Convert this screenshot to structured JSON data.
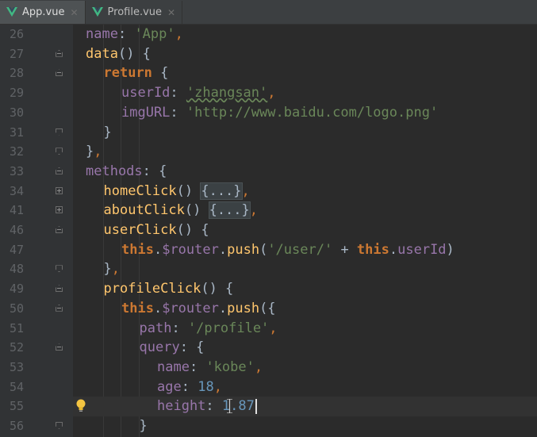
{
  "tabs": [
    {
      "label": "App.vue",
      "icon": "vue-icon",
      "active": true
    },
    {
      "label": "Profile.vue",
      "icon": "vue-icon",
      "active": false
    }
  ],
  "colors": {
    "background": "#2b2b2b",
    "gutter": "#313335",
    "vue_green": "#41b883",
    "keyword": "#cc7832",
    "string": "#6a8759",
    "property": "#9876aa",
    "function": "#ffc66d",
    "number": "#6897bb"
  },
  "editor": {
    "current_line_number": "55",
    "lines": [
      {
        "num": "26",
        "fold": "",
        "tokens": [
          {
            "t": "name",
            "c": "tok-prop"
          },
          {
            "t": ": ",
            "c": "tok-plain"
          },
          {
            "t": "'App'",
            "c": "tok-str"
          },
          {
            "t": ",",
            "c": "tok-punc"
          }
        ],
        "indent": 0
      },
      {
        "num": "27",
        "fold": "open-top",
        "tokens": [
          {
            "t": "data",
            "c": "tok-fn"
          },
          {
            "t": "() {",
            "c": "tok-plain"
          }
        ],
        "indent": 0
      },
      {
        "num": "28",
        "fold": "open-top",
        "tokens": [
          {
            "t": "return",
            "c": "tok-kw"
          },
          {
            "t": " {",
            "c": "tok-plain"
          }
        ],
        "indent": 1
      },
      {
        "num": "29",
        "fold": "",
        "tokens": [
          {
            "t": "userId",
            "c": "tok-prop"
          },
          {
            "t": ": ",
            "c": "tok-plain"
          },
          {
            "t": "'zhangsan'",
            "c": "tok-str tok-underline"
          },
          {
            "t": ",",
            "c": "tok-punc"
          }
        ],
        "indent": 2
      },
      {
        "num": "30",
        "fold": "",
        "tokens": [
          {
            "t": "imgURL",
            "c": "tok-prop"
          },
          {
            "t": ": ",
            "c": "tok-plain"
          },
          {
            "t": "'http://www.baidu.com/logo.png'",
            "c": "tok-str"
          }
        ],
        "indent": 2
      },
      {
        "num": "31",
        "fold": "close-bottom",
        "tokens": [
          {
            "t": "}",
            "c": "tok-plain"
          }
        ],
        "indent": 1
      },
      {
        "num": "32",
        "fold": "close-bottom",
        "tokens": [
          {
            "t": "}",
            "c": "tok-plain"
          },
          {
            "t": ",",
            "c": "tok-punc"
          }
        ],
        "indent": 0
      },
      {
        "num": "33",
        "fold": "open-top",
        "tokens": [
          {
            "t": "methods",
            "c": "tok-prop"
          },
          {
            "t": ": {",
            "c": "tok-plain"
          }
        ],
        "indent": 0
      },
      {
        "num": "34",
        "fold": "plus",
        "tokens": [
          {
            "t": "homeClick",
            "c": "tok-fn"
          },
          {
            "t": "() ",
            "c": "tok-plain"
          },
          {
            "t": "{...}",
            "c": "tok-fold"
          },
          {
            "t": ",",
            "c": "tok-punc"
          }
        ],
        "indent": 1
      },
      {
        "num": "41",
        "fold": "plus",
        "tokens": [
          {
            "t": "aboutClick",
            "c": "tok-fn"
          },
          {
            "t": "() ",
            "c": "tok-plain"
          },
          {
            "t": "{...}",
            "c": "tok-fold"
          },
          {
            "t": ",",
            "c": "tok-punc"
          }
        ],
        "indent": 1
      },
      {
        "num": "46",
        "fold": "open-top",
        "tokens": [
          {
            "t": "userClick",
            "c": "tok-fn"
          },
          {
            "t": "() {",
            "c": "tok-plain"
          }
        ],
        "indent": 1
      },
      {
        "num": "47",
        "fold": "",
        "tokens": [
          {
            "t": "this",
            "c": "tok-kw"
          },
          {
            "t": ".",
            "c": "tok-plain"
          },
          {
            "t": "$router",
            "c": "tok-prop"
          },
          {
            "t": ".",
            "c": "tok-plain"
          },
          {
            "t": "push",
            "c": "tok-fn"
          },
          {
            "t": "(",
            "c": "tok-plain"
          },
          {
            "t": "'/user/'",
            "c": "tok-str"
          },
          {
            "t": " + ",
            "c": "tok-plain"
          },
          {
            "t": "this",
            "c": "tok-kw"
          },
          {
            "t": ".",
            "c": "tok-plain"
          },
          {
            "t": "userId",
            "c": "tok-prop"
          },
          {
            "t": ")",
            "c": "tok-plain"
          }
        ],
        "indent": 2
      },
      {
        "num": "48",
        "fold": "close-bottom",
        "tokens": [
          {
            "t": "}",
            "c": "tok-plain"
          },
          {
            "t": ",",
            "c": "tok-punc"
          }
        ],
        "indent": 1
      },
      {
        "num": "49",
        "fold": "open-top",
        "tokens": [
          {
            "t": "profileClick",
            "c": "tok-fn"
          },
          {
            "t": "() {",
            "c": "tok-plain"
          }
        ],
        "indent": 1
      },
      {
        "num": "50",
        "fold": "open-top",
        "tokens": [
          {
            "t": "this",
            "c": "tok-kw"
          },
          {
            "t": ".",
            "c": "tok-plain"
          },
          {
            "t": "$router",
            "c": "tok-prop"
          },
          {
            "t": ".",
            "c": "tok-plain"
          },
          {
            "t": "push",
            "c": "tok-fn"
          },
          {
            "t": "({",
            "c": "tok-plain"
          }
        ],
        "indent": 2
      },
      {
        "num": "51",
        "fold": "",
        "tokens": [
          {
            "t": "path",
            "c": "tok-prop"
          },
          {
            "t": ": ",
            "c": "tok-plain"
          },
          {
            "t": "'/profile'",
            "c": "tok-str"
          },
          {
            "t": ",",
            "c": "tok-punc"
          }
        ],
        "indent": 3
      },
      {
        "num": "52",
        "fold": "open-top",
        "tokens": [
          {
            "t": "query",
            "c": "tok-prop"
          },
          {
            "t": ": {",
            "c": "tok-plain"
          }
        ],
        "indent": 3
      },
      {
        "num": "53",
        "fold": "",
        "tokens": [
          {
            "t": "name",
            "c": "tok-prop"
          },
          {
            "t": ": ",
            "c": "tok-plain"
          },
          {
            "t": "'kobe'",
            "c": "tok-str"
          },
          {
            "t": ",",
            "c": "tok-punc"
          }
        ],
        "indent": 4
      },
      {
        "num": "54",
        "fold": "",
        "tokens": [
          {
            "t": "age",
            "c": "tok-prop"
          },
          {
            "t": ": ",
            "c": "tok-plain"
          },
          {
            "t": "18",
            "c": "tok-num"
          },
          {
            "t": ",",
            "c": "tok-punc"
          }
        ],
        "indent": 4
      },
      {
        "num": "55",
        "fold": "",
        "tokens": [
          {
            "t": "height",
            "c": "tok-prop"
          },
          {
            "t": ": ",
            "c": "tok-plain"
          },
          {
            "t": "1.87",
            "c": "tok-num"
          }
        ],
        "indent": 4
      },
      {
        "num": "56",
        "fold": "close-bottom",
        "tokens": [
          {
            "t": "}",
            "c": "tok-plain"
          }
        ],
        "indent": 3
      }
    ]
  }
}
